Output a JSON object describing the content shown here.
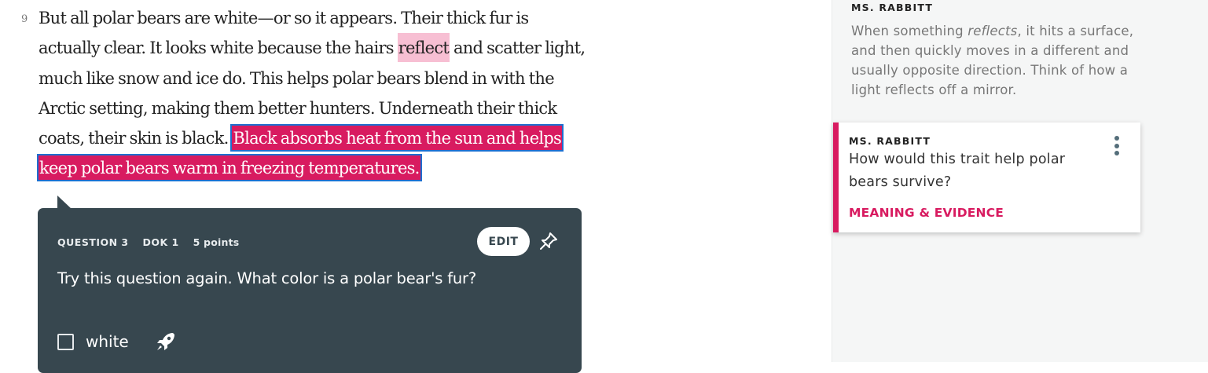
{
  "passage": {
    "paragraph_number": "9",
    "text_before_highlight": "But all polar bears are white—or so it appears. Their thick fur is actually clear. It looks white because the hairs ",
    "highlighted_word": "reflect",
    "text_middle": " and scatter light, much like snow and ice do. This helps polar bears blend in with the Arctic setting, making them better hunters. Underneath their thick coats, their skin is black. ",
    "selected_sentence": "Black absorbs heat from the sun and helps keep polar bears warm in freezing temperatures."
  },
  "question": {
    "number_label": "QUESTION 3",
    "dok_label": "DOK 1",
    "points_label": "5 points",
    "edit_label": "EDIT",
    "text": "Try this question again. What color is a polar bear's fur?",
    "answer_option": "white"
  },
  "sidebar": {
    "note_definition": {
      "author": "MS. RABBITT",
      "body_before": "When something ",
      "body_emphasis": "reflects",
      "body_after": ", it hits a surface, and then quickly moves in a different and usually opposite direction. Think of how a light reflects off a mirror."
    },
    "note_question": {
      "author": "MS. RABBITT",
      "body": "How would this trait help polar bears survive?",
      "tag": "MEANING & EVIDENCE"
    }
  },
  "colors": {
    "accent_magenta": "#d81b60",
    "highlight_pink": "#f7bfd3",
    "question_card_bg": "#37474f",
    "selection_outline": "#1e6fd0"
  },
  "icons": [
    "pin-icon",
    "rocket-icon",
    "kebab-menu-icon",
    "checkbox-icon"
  ]
}
